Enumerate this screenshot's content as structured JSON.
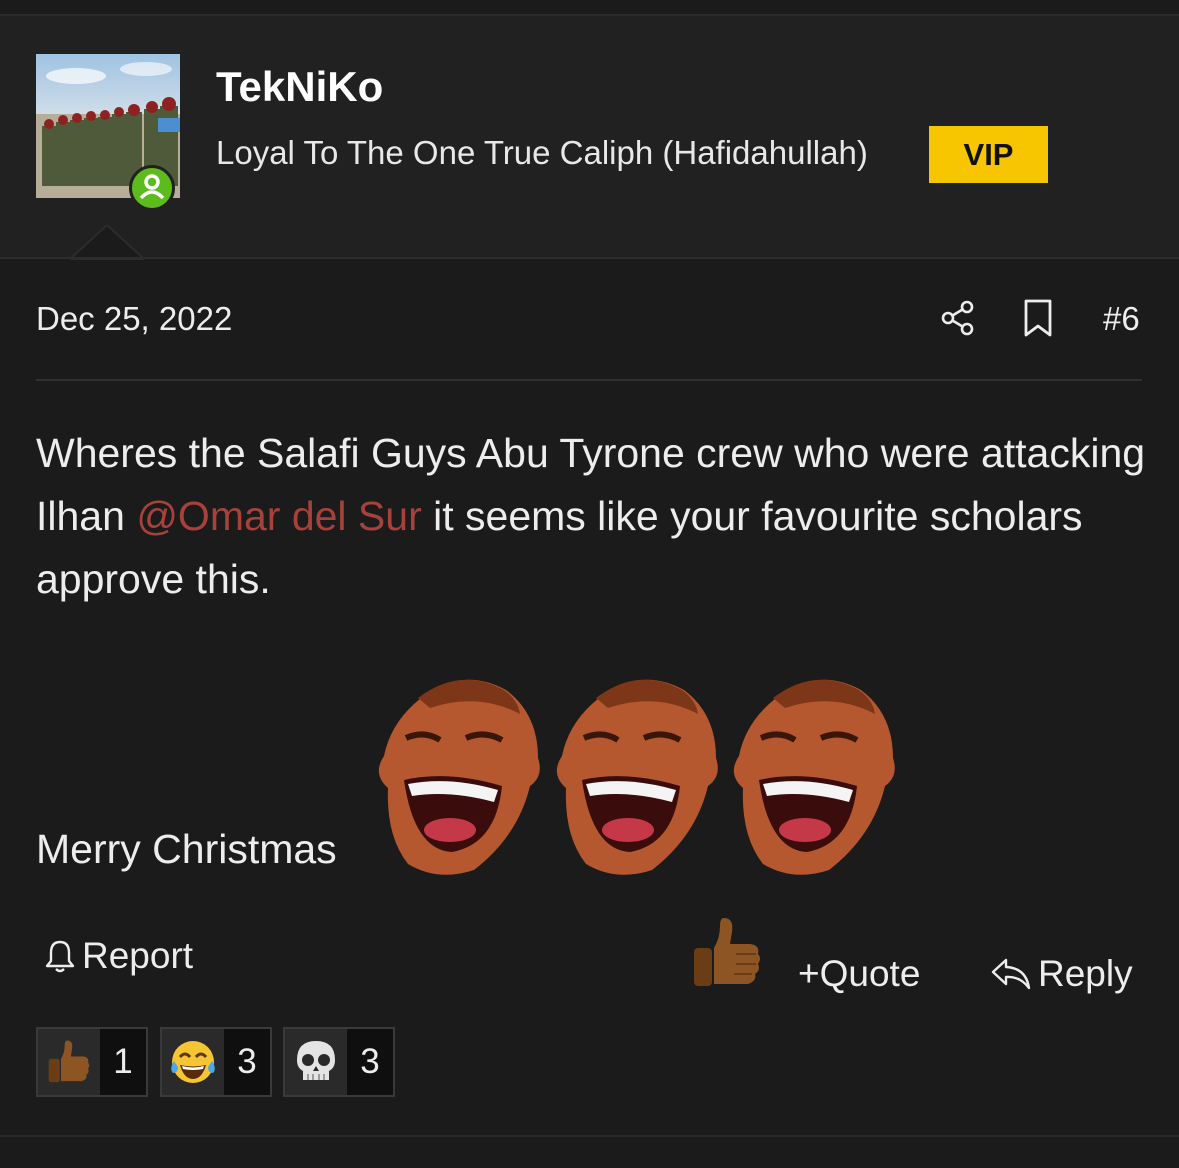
{
  "user": {
    "username": "TekNiKo",
    "title": "Loyal To The One True Caliph (Hafidahullah)",
    "badge": "VIP",
    "online": true
  },
  "post": {
    "date": "Dec 25, 2022",
    "number": "#6",
    "body_before_mention": "Wheres the Salafi Guys Abu Tyrone crew who were attacking Ilhan ",
    "mention": "@Omar del Sur",
    "body_after_mention": " it seems like your favourite scholars approve this.",
    "closing": "Merry Christmas",
    "inline_emojis": [
      "laughing-face",
      "laughing-face",
      "laughing-face"
    ]
  },
  "actions": {
    "report": "Report",
    "quote": "Quote",
    "reply": "Reply",
    "like_icon": "thumbs-up-icon"
  },
  "reactions": [
    {
      "icon": "thumbs-up-icon",
      "count": "1"
    },
    {
      "icon": "tears-of-joy-icon",
      "count": "3"
    },
    {
      "icon": "skull-icon",
      "count": "3"
    }
  ],
  "colors": {
    "background": "#1b1b1b",
    "user_block": "#212121",
    "vip": "#f7c600",
    "mention": "#a8413a",
    "online": "#5dbb1e"
  }
}
